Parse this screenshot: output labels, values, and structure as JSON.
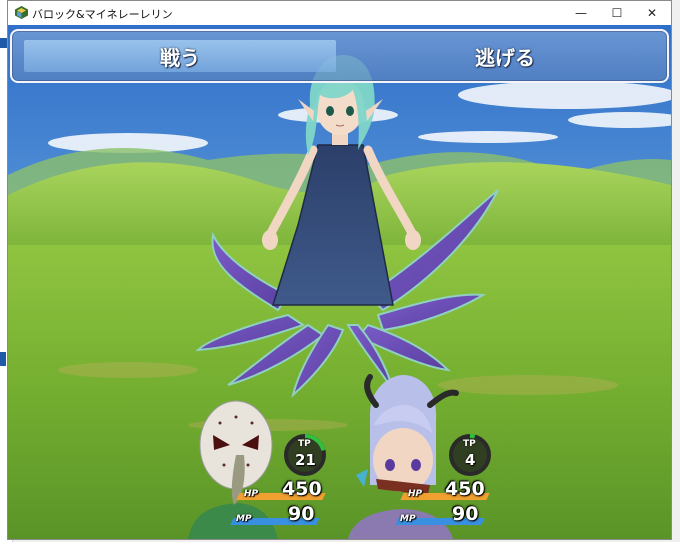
{
  "window": {
    "title": "バロック&マイネレーレリン",
    "minimize_glyph": "—",
    "maximize_glyph": "☐",
    "close_glyph": "✕"
  },
  "commands": [
    {
      "label": "戦う",
      "selected": true
    },
    {
      "label": "逃げる",
      "selected": false
    }
  ],
  "party": [
    {
      "name_icon": "skull-mask-actor",
      "tp_label": "TP",
      "tp": "21",
      "tp_fraction": 0.21,
      "hp_label": "HP",
      "hp": "450",
      "mp_label": "MP",
      "mp": "90"
    },
    {
      "name_icon": "horned-girl-actor",
      "tp_label": "TP",
      "tp": "4",
      "tp_fraction": 0.04,
      "hp_label": "HP",
      "hp": "450",
      "mp_label": "MP",
      "mp": "90"
    }
  ],
  "colors": {
    "hp_gauge": "#f0a030",
    "mp_gauge": "#3a90e0",
    "tp_gauge": "#30c040",
    "sky_top": "#3a7bd0",
    "grass": "#7fbf3a"
  },
  "enemy": {
    "icon": "scylla-girl-enemy"
  }
}
